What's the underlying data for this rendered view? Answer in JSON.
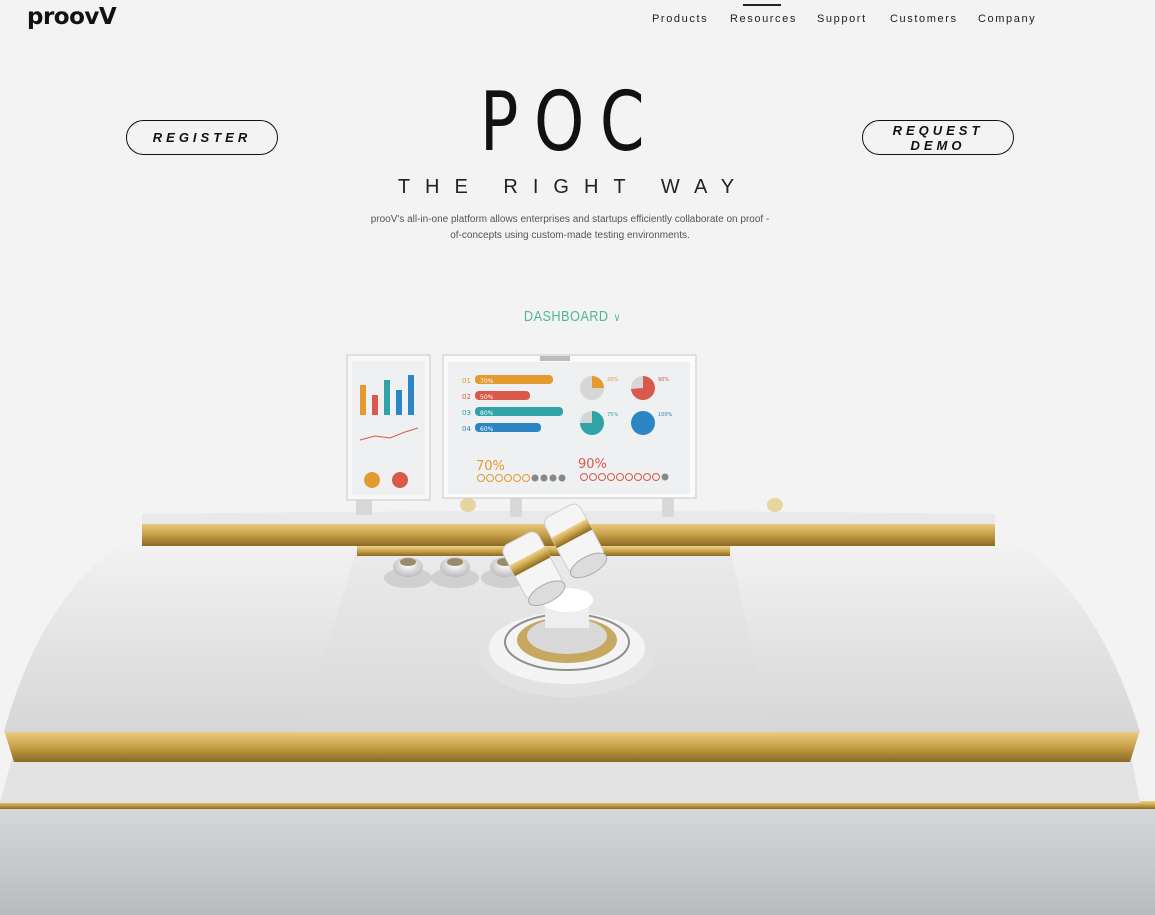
{
  "header": {
    "logo": "proov",
    "nav": [
      {
        "label": "Products"
      },
      {
        "label": "Resources",
        "active": true
      },
      {
        "label": "Support"
      },
      {
        "label": "Customers"
      },
      {
        "label": "Company"
      }
    ]
  },
  "hero": {
    "title": "POC",
    "subtitle": "THE RIGHT WAY",
    "description": "prooV's all-in-one platform allows enterprises and startups efficiently collaborate on proof -of-concepts using custom-made testing environments.",
    "register_label": "REGISTER",
    "demo_label": "REQUEST DEMO",
    "dashboard_label": "DASHBOARD"
  },
  "illustration": {
    "bars": [
      {
        "label": "01",
        "value": "70%",
        "color": "#e39a2e"
      },
      {
        "label": "02",
        "value": "50%",
        "color": "#d9594a"
      },
      {
        "label": "03",
        "value": "80%",
        "color": "#2fa3a5"
      },
      {
        "label": "04",
        "value": "60%",
        "color": "#2c86c4"
      }
    ],
    "pies": [
      "20%",
      "90%",
      "75%",
      "100%"
    ],
    "stat_left": "70%",
    "stat_right": "90%",
    "colors": {
      "gold": "#c9a24a",
      "accent": "#4fb898"
    }
  }
}
